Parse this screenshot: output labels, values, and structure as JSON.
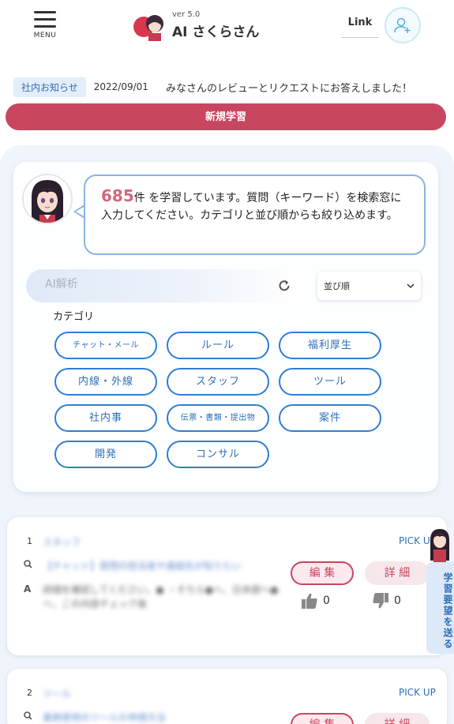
{
  "header": {
    "menu_label": "MENU",
    "version": "ver 5.0",
    "title": "AI さくらさん",
    "link_label": "Link"
  },
  "notice": {
    "badge": "社内お知らせ",
    "date": "2022/09/01",
    "text": "みなさんのレビューとリクエストにお答えしました！"
  },
  "new_learning_label": "新規学習",
  "intro": {
    "count": "685",
    "text_after_count": "件 を学習しています。質問（キーワード）を検索窓に入力してください。カテゴリと並び順からも絞り込めます。"
  },
  "search": {
    "placeholder": "AI解析"
  },
  "sort": {
    "selected": "並び順"
  },
  "categories_label": "カテゴリ",
  "categories": [
    "チャット・メール",
    "ルール",
    "福利厚生",
    "内線・外線",
    "スタッフ",
    "ツール",
    "社内事",
    "伝票・書類・提出物",
    "案件",
    "開発",
    "コンサル"
  ],
  "results": [
    {
      "rank": "1",
      "pickup": "PICK UP",
      "category": "スタッフ",
      "question": "【チャット】質問の担当者や連絡先が知りたい",
      "answer": "詳細を確認してください。● ・そちら●へ、日本語へ●へ、この内容チェック後",
      "edit_label": "編 集",
      "detail_label": "詳 細",
      "likes": "0",
      "dislikes": "0"
    },
    {
      "rank": "2",
      "pickup": "PICK UP",
      "category": "ツール",
      "question": "業務使用のツールの申請方法",
      "edit_label": "編 集",
      "detail_label": "詳 細"
    }
  ],
  "side_tab": {
    "label": "学習要望を送る"
  },
  "colors": {
    "accent": "#c94661",
    "primary": "#2f7dd3",
    "count": "#d4667b"
  }
}
